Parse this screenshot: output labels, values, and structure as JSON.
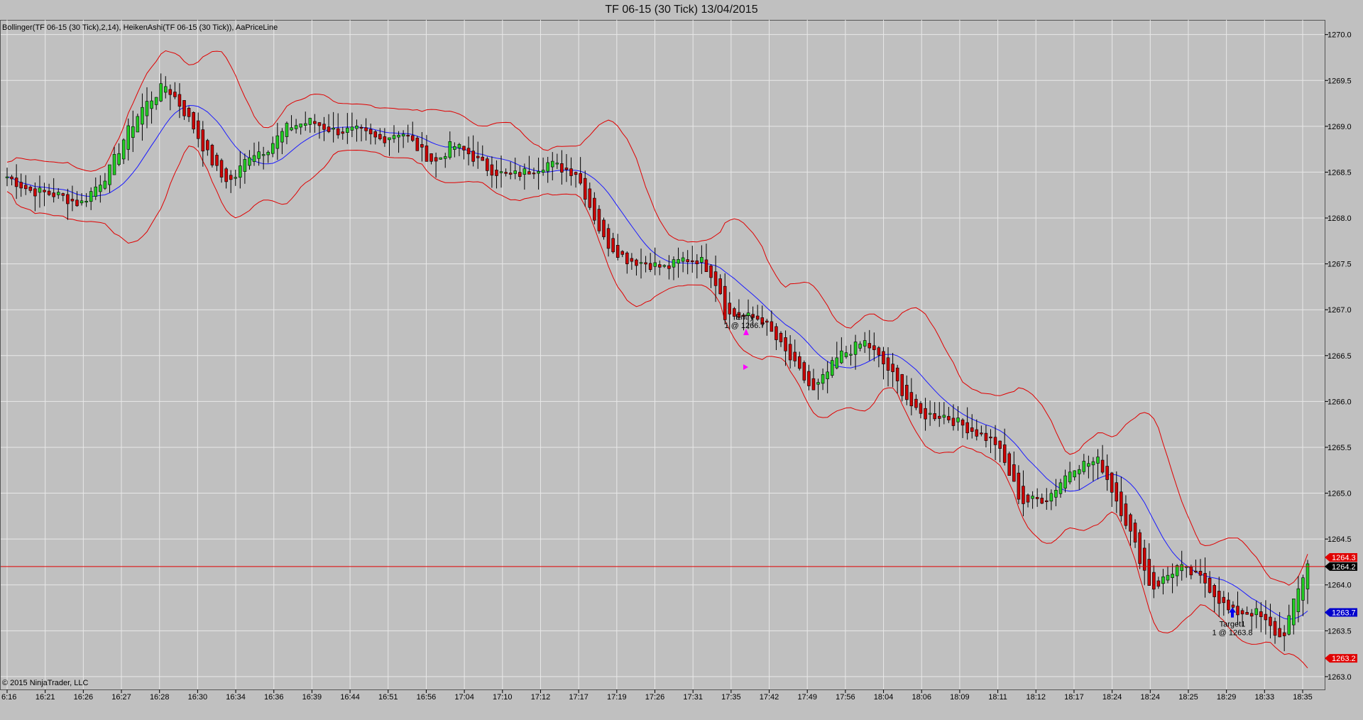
{
  "window": {
    "title": "TF 06-15 (30 Tick)  13/04/2015"
  },
  "chart_data": {
    "type": "candlestick",
    "indicator_label": "Bollinger(TF 06-15 (30 Tick),2,14), HeikenAshi(TF 06-15 (30 Tick)), AaPriceLine",
    "copyright": "© 2015 NinjaTrader, LLC",
    "y_ticks": [
      1270.0,
      1269.5,
      1269.0,
      1268.5,
      1268.0,
      1267.5,
      1267.0,
      1266.5,
      1266.0,
      1265.5,
      1265.0,
      1264.5,
      1264.0,
      1263.5,
      1263.0
    ],
    "x_ticks": [
      "6:16",
      "16:21",
      "16:26",
      "16:27",
      "16:28",
      "16:30",
      "16:34",
      "16:36",
      "16:39",
      "16:44",
      "16:51",
      "16:56",
      "17:04",
      "17:10",
      "17:12",
      "17:17",
      "17:19",
      "17:26",
      "17:31",
      "17:35",
      "17:42",
      "17:49",
      "17:56",
      "18:04",
      "18:06",
      "18:09",
      "18:11",
      "18:12",
      "18:17",
      "18:24",
      "18:24",
      "18:25",
      "18:29",
      "18:33",
      "18:35"
    ],
    "ylim": [
      1262.86,
      1270.16
    ],
    "grid": true,
    "price_line": 1264.2,
    "price_markers": [
      {
        "text": "1264.3",
        "value": 1264.3,
        "color": "#e00000"
      },
      {
        "text": "1264.2",
        "value": 1264.2,
        "color": "#000000"
      },
      {
        "text": "1263.7",
        "value": 1263.7,
        "color": "#0000cc"
      },
      {
        "text": "1263.2",
        "value": 1263.2,
        "color": "#e00000"
      }
    ],
    "annotations": [
      {
        "line1": "Entry",
        "line2": "1 @ 1266.7",
        "value": 1266.7,
        "kind": "entry"
      },
      {
        "line1": "Target1",
        "line2": "1 @ 1263.8",
        "value": 1263.8,
        "kind": "target"
      }
    ],
    "bar_count": 280,
    "close_path": [
      [
        0,
        1268.45
      ],
      [
        8,
        1268.3
      ],
      [
        18,
        1268.25
      ],
      [
        26,
        1268.15
      ],
      [
        36,
        1268.5
      ],
      [
        42,
        1268.9
      ],
      [
        48,
        1269.2
      ],
      [
        56,
        1269.45
      ],
      [
        60,
        1269.3
      ],
      [
        66,
        1269.0
      ],
      [
        70,
        1268.75
      ],
      [
        76,
        1268.45
      ],
      [
        80,
        1268.4
      ],
      [
        86,
        1268.7
      ],
      [
        92,
        1268.75
      ],
      [
        100,
        1269.0
      ],
      [
        108,
        1269.05
      ],
      [
        116,
        1268.95
      ],
      [
        124,
        1268.95
      ],
      [
        132,
        1268.85
      ],
      [
        140,
        1268.95
      ],
      [
        146,
        1268.75
      ],
      [
        152,
        1268.6
      ],
      [
        158,
        1268.8
      ],
      [
        164,
        1268.7
      ],
      [
        170,
        1268.55
      ],
      [
        178,
        1268.45
      ],
      [
        184,
        1268.5
      ],
      [
        192,
        1268.6
      ],
      [
        196,
        1268.55
      ],
      [
        202,
        1268.5
      ],
      [
        206,
        1268.2
      ],
      [
        212,
        1267.75
      ],
      [
        220,
        1267.55
      ],
      [
        228,
        1267.5
      ],
      [
        234,
        1267.45
      ],
      [
        240,
        1267.55
      ],
      [
        246,
        1267.55
      ],
      [
        250,
        1267.4
      ],
      [
        254,
        1267.15
      ]
    ],
    "series": [
      {
        "name": "Bollinger",
        "color": "#e00000"
      },
      {
        "name": "HeikenAshi",
        "color_up": "#22cc22",
        "color_down": "#cc0000"
      }
    ]
  }
}
